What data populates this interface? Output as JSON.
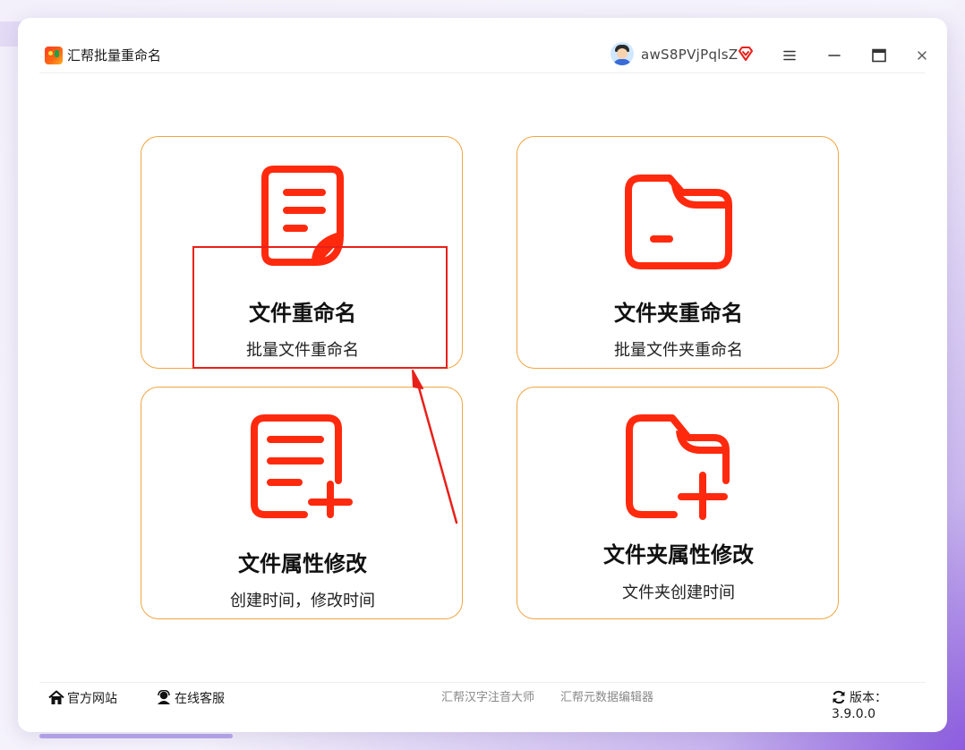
{
  "app": {
    "title": "汇帮批量重命名",
    "username": "awS8PVjPqlsZ",
    "icons": {
      "logo": "app-logo-icon",
      "vip": "vip-diamond-icon",
      "menu": "menu-icon",
      "minimize": "minimize-icon",
      "maximize": "maximize-icon",
      "close": "close-icon"
    }
  },
  "cards": [
    {
      "title": "文件重命名",
      "subtitle": "批量文件重命名",
      "icon": "document-icon"
    },
    {
      "title": "文件夹重命名",
      "subtitle": "批量文件夹重命名",
      "icon": "folder-icon"
    },
    {
      "title": "文件属性修改",
      "subtitle": "创建时间，修改时间",
      "icon": "document-add-icon"
    },
    {
      "title": "文件夹属性修改",
      "subtitle": "文件夹创建时间",
      "icon": "folder-add-icon"
    }
  ],
  "footer": {
    "official_site": "官方网站",
    "online_service": "在线客服",
    "app_link_1": "汇帮汉字注音大师",
    "app_link_2": "汇帮元数据编辑器",
    "version_label": "版本：",
    "version_value": "3.9.0.0"
  },
  "colors": {
    "accent_red": "#ff2a0e",
    "card_border": "#f0a542",
    "annotation": "#e8201a"
  }
}
